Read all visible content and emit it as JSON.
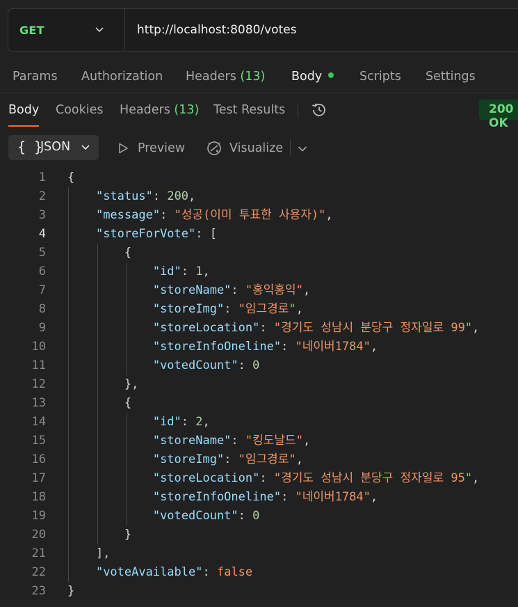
{
  "request": {
    "method": "GET",
    "url": "http://localhost:8080/votes"
  },
  "request_tabs": {
    "params": "Params",
    "authorization": "Authorization",
    "headers": "Headers",
    "headers_count": "(13)",
    "body": "Body",
    "scripts": "Scripts",
    "settings": "Settings"
  },
  "response_tabs": {
    "body": "Body",
    "cookies": "Cookies",
    "headers": "Headers",
    "headers_count": "(13)",
    "test_results": "Test Results",
    "status": "200 OK"
  },
  "toolbar": {
    "format": "JSON",
    "braces": "{ }",
    "preview": "Preview",
    "visualize": "Visualize"
  },
  "colors": {
    "method_green": "#6bd97e",
    "active_tab_underline": "#f26b3a",
    "json_key": "#9cdcfe",
    "json_string": "#ee9566",
    "json_number": "#b5cea8"
  },
  "code_lines": [
    {
      "n": "1",
      "parts": [
        [
          "p",
          "{"
        ]
      ]
    },
    {
      "n": "2",
      "parts": [
        [
          "p",
          "    "
        ],
        [
          "k",
          "\"status\""
        ],
        [
          "p",
          ": "
        ],
        [
          "n",
          "200"
        ],
        [
          "p",
          ","
        ]
      ]
    },
    {
      "n": "3",
      "parts": [
        [
          "p",
          "    "
        ],
        [
          "k",
          "\"message\""
        ],
        [
          "p",
          ": "
        ],
        [
          "s",
          "\"성공(이미 투표한 사용자)\""
        ],
        [
          "p",
          ","
        ]
      ]
    },
    {
      "n": "4",
      "parts": [
        [
          "p",
          "    "
        ],
        [
          "k",
          "\"storeForVote\""
        ],
        [
          "p",
          ": ["
        ]
      ]
    },
    {
      "n": "5",
      "parts": [
        [
          "p",
          "        {"
        ]
      ]
    },
    {
      "n": "6",
      "parts": [
        [
          "p",
          "            "
        ],
        [
          "k",
          "\"id\""
        ],
        [
          "p",
          ": "
        ],
        [
          "n",
          "1"
        ],
        [
          "p",
          ","
        ]
      ]
    },
    {
      "n": "7",
      "parts": [
        [
          "p",
          "            "
        ],
        [
          "k",
          "\"storeName\""
        ],
        [
          "p",
          ": "
        ],
        [
          "s",
          "\"홍익홍익\""
        ],
        [
          "p",
          ","
        ]
      ]
    },
    {
      "n": "8",
      "parts": [
        [
          "p",
          "            "
        ],
        [
          "k",
          "\"storeImg\""
        ],
        [
          "p",
          ": "
        ],
        [
          "s",
          "\"임그경로\""
        ],
        [
          "p",
          ","
        ]
      ]
    },
    {
      "n": "9",
      "parts": [
        [
          "p",
          "            "
        ],
        [
          "k",
          "\"storeLocation\""
        ],
        [
          "p",
          ": "
        ],
        [
          "s",
          "\"경기도 성남시 분당구 정자일로 99\""
        ],
        [
          "p",
          ","
        ]
      ]
    },
    {
      "n": "10",
      "parts": [
        [
          "p",
          "            "
        ],
        [
          "k",
          "\"storeInfoOneline\""
        ],
        [
          "p",
          ": "
        ],
        [
          "s",
          "\"네이버1784\""
        ],
        [
          "p",
          ","
        ]
      ]
    },
    {
      "n": "11",
      "parts": [
        [
          "p",
          "            "
        ],
        [
          "k",
          "\"votedCount\""
        ],
        [
          "p",
          ": "
        ],
        [
          "n",
          "0"
        ]
      ]
    },
    {
      "n": "12",
      "parts": [
        [
          "p",
          "        },"
        ]
      ]
    },
    {
      "n": "13",
      "parts": [
        [
          "p",
          "        {"
        ]
      ]
    },
    {
      "n": "14",
      "parts": [
        [
          "p",
          "            "
        ],
        [
          "k",
          "\"id\""
        ],
        [
          "p",
          ": "
        ],
        [
          "n",
          "2"
        ],
        [
          "p",
          ","
        ]
      ]
    },
    {
      "n": "15",
      "parts": [
        [
          "p",
          "            "
        ],
        [
          "k",
          "\"storeName\""
        ],
        [
          "p",
          ": "
        ],
        [
          "s",
          "\"킹도날드\""
        ],
        [
          "p",
          ","
        ]
      ]
    },
    {
      "n": "16",
      "parts": [
        [
          "p",
          "            "
        ],
        [
          "k",
          "\"storeImg\""
        ],
        [
          "p",
          ": "
        ],
        [
          "s",
          "\"임그경로\""
        ],
        [
          "p",
          ","
        ]
      ]
    },
    {
      "n": "17",
      "parts": [
        [
          "p",
          "            "
        ],
        [
          "k",
          "\"storeLocation\""
        ],
        [
          "p",
          ": "
        ],
        [
          "s",
          "\"경기도 성남시 분당구 정자일로 95\""
        ],
        [
          "p",
          ","
        ]
      ]
    },
    {
      "n": "18",
      "parts": [
        [
          "p",
          "            "
        ],
        [
          "k",
          "\"storeInfoOneline\""
        ],
        [
          "p",
          ": "
        ],
        [
          "s",
          "\"네이버1784\""
        ],
        [
          "p",
          ","
        ]
      ]
    },
    {
      "n": "19",
      "parts": [
        [
          "p",
          "            "
        ],
        [
          "k",
          "\"votedCount\""
        ],
        [
          "p",
          ": "
        ],
        [
          "n",
          "0"
        ]
      ]
    },
    {
      "n": "20",
      "parts": [
        [
          "p",
          "        }"
        ]
      ]
    },
    {
      "n": "21",
      "parts": [
        [
          "p",
          "    ],"
        ]
      ]
    },
    {
      "n": "22",
      "parts": [
        [
          "p",
          "    "
        ],
        [
          "k",
          "\"voteAvailable\""
        ],
        [
          "p",
          ": "
        ],
        [
          "b",
          "false"
        ]
      ]
    },
    {
      "n": "23",
      "parts": [
        [
          "p",
          "}"
        ]
      ]
    }
  ],
  "current_line": "4"
}
